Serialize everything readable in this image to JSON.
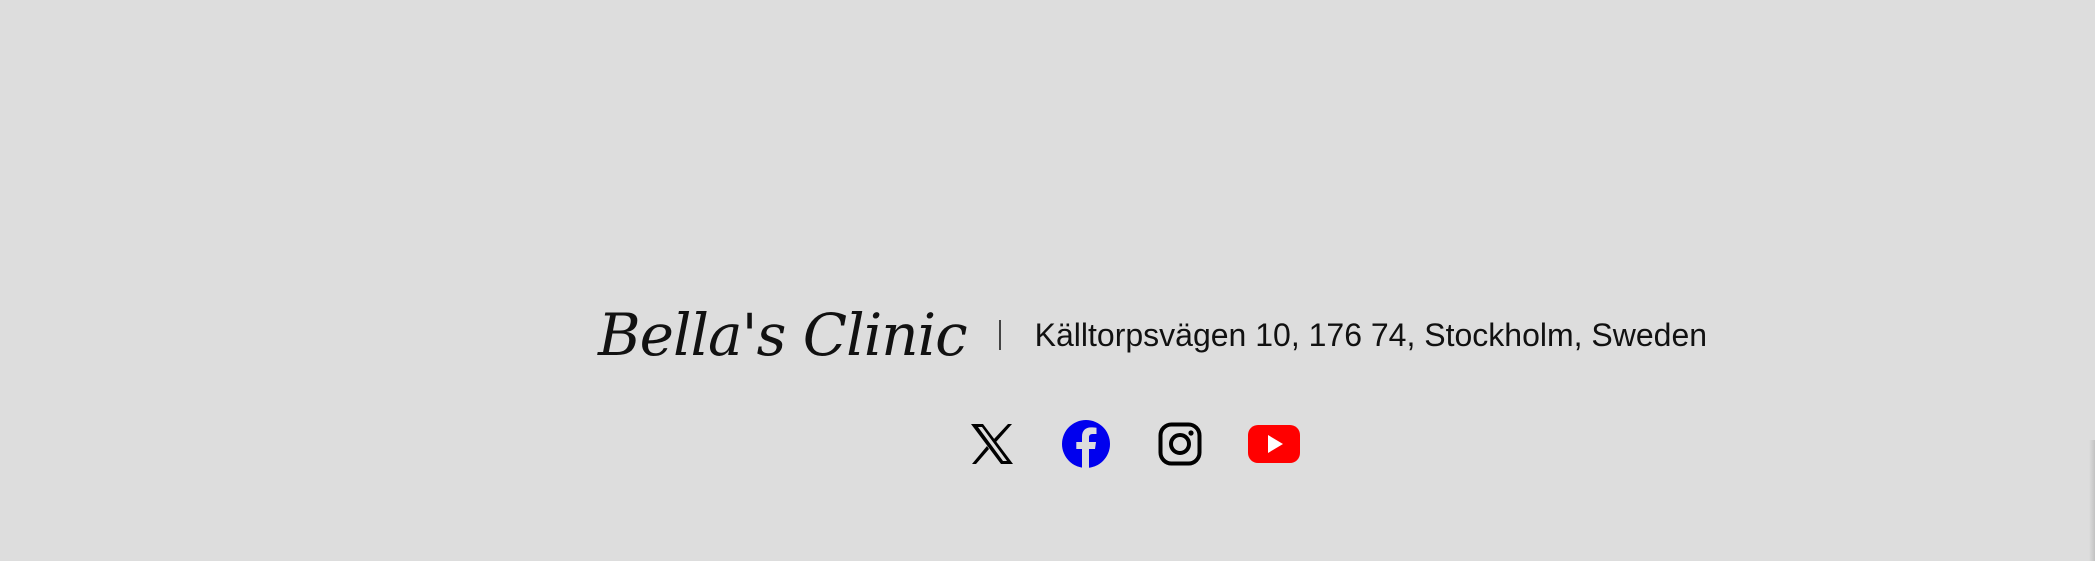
{
  "footer": {
    "logo": "Bella's Clinic",
    "address": "Källtorpsvägen 10, 176 74, Stockholm, Sweden"
  },
  "social": [
    {
      "icon": "x-icon",
      "color": "#000000"
    },
    {
      "icon": "facebook-icon",
      "color": "#0000ee"
    },
    {
      "icon": "instagram-icon",
      "color": "#000000"
    },
    {
      "icon": "youtube-icon",
      "color": "#ff0000"
    }
  ],
  "colors": {
    "background": "#dddddd",
    "text": "#111111"
  }
}
